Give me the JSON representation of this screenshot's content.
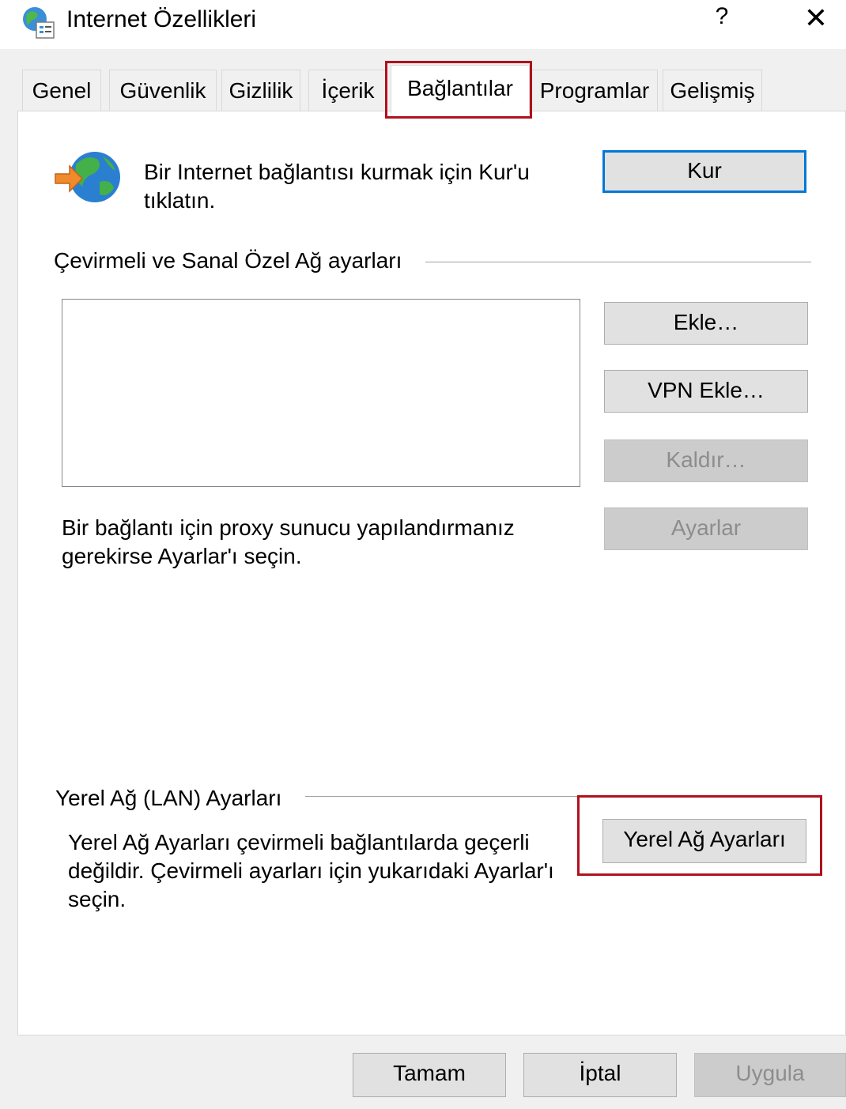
{
  "window": {
    "title": "Internet Özellikleri",
    "help_label": "?",
    "close_label": "✕",
    "app_icon": "internet-options-icon"
  },
  "tabs": [
    {
      "label": "Genel"
    },
    {
      "label": "Güvenlik"
    },
    {
      "label": "Gizlilik"
    },
    {
      "label": "İçerik"
    },
    {
      "label": "Bağlantılar",
      "selected": true
    },
    {
      "label": "Programlar"
    },
    {
      "label": "Gelişmiş"
    }
  ],
  "setup": {
    "icon": "globe-connect-icon",
    "text_line1": "Bir Internet bağlantısı kurmak için Kur'u",
    "text_line2": "tıklatın.",
    "button_label": "Kur"
  },
  "dialup": {
    "group_label": "Çevirmeli ve Sanal Özel Ağ ayarları",
    "add_label": "Ekle…",
    "add_vpn_label": "VPN Ekle…",
    "remove_label": "Kaldır…",
    "settings_label": "Ayarlar",
    "proxy_text_line1": "Bir bağlantı için proxy sunucu yapılandırmanız",
    "proxy_text_line2": "gerekirse Ayarlar'ı seçin."
  },
  "lan": {
    "group_label": "Yerel Ağ (LAN) Ayarları",
    "text_line1": "Yerel Ağ Ayarları çevirmeli bağlantılarda geçerli",
    "text_line2": "değildir. Çevirmeli ayarları için yukarıdaki Ayarlar'ı",
    "text_line3": "seçin.",
    "button_label": "Yerel Ağ Ayarları"
  },
  "footer": {
    "ok_label": "Tamam",
    "cancel_label": "İptal",
    "apply_label": "Uygula"
  },
  "colors": {
    "highlight": "#b0111d",
    "focus_border": "#0078d7"
  }
}
